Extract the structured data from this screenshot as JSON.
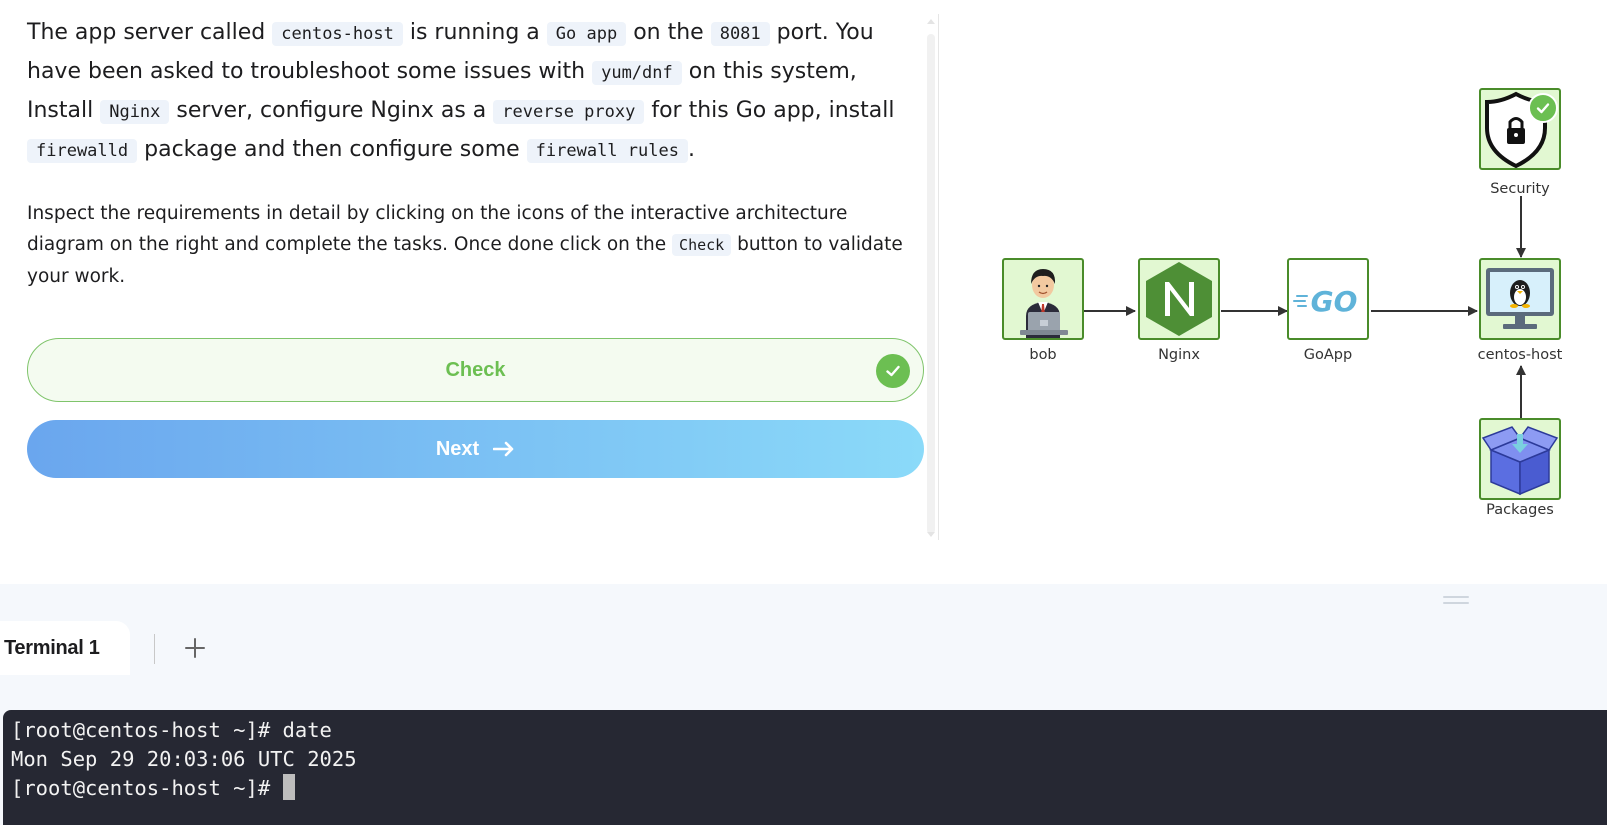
{
  "task": {
    "intro": {
      "t1": "The app server called ",
      "c1": "centos-host",
      "t2": " is running a ",
      "c2": "Go app",
      "t3": " on the ",
      "c3": "8081",
      "t4": " port. You have been asked to troubleshoot some issues with ",
      "c4": "yum/dnf",
      "t5": " on this system, Install ",
      "c5": "Nginx",
      "t6": " server, configure Nginx as a ",
      "c6": "reverse proxy",
      "t7": " for this Go app, install ",
      "c7": "firewalld",
      "t8": " package and then configure some ",
      "c8": "firewall rules",
      "t9": "."
    },
    "detail": {
      "t1": "Inspect the requirements in detail by clicking on the icons of the interactive architecture diagram on the right and complete the tasks. Once done click on the ",
      "c1": "Check",
      "t2": " button to validate your work."
    },
    "check_label": "Check",
    "next_label": "Next"
  },
  "diagram": {
    "nodes": [
      {
        "id": "bob",
        "label": "bob",
        "icon": "user-at-laptop-icon"
      },
      {
        "id": "nginx",
        "label": "Nginx",
        "icon": "nginx-logo-icon"
      },
      {
        "id": "goapp",
        "label": "GoApp",
        "icon": "go-logo-icon"
      },
      {
        "id": "centos-host",
        "label": "centos-host",
        "icon": "linux-monitor-icon"
      },
      {
        "id": "security",
        "label": "Security",
        "icon": "shield-lock-icon",
        "status": "completed"
      },
      {
        "id": "packages",
        "label": "Packages",
        "icon": "package-box-icon"
      }
    ],
    "node_border_color": "#4a8c2a",
    "node_fill_color": "#e2f8d2"
  },
  "terminal": {
    "tabs": [
      {
        "label": "Terminal 1",
        "active": true
      }
    ],
    "add_tab_icon": "plus-icon",
    "lines": [
      "[root@centos-host ~]# date",
      "Mon Sep 29 20:03:06 UTC 2025",
      "[root@centos-host ~]# "
    ]
  },
  "colors": {
    "check_green": "#6cbf52",
    "next_gradient_start": "#6aa6ee",
    "next_gradient_end": "#8bdaf9",
    "terminal_bg": "#262833"
  }
}
